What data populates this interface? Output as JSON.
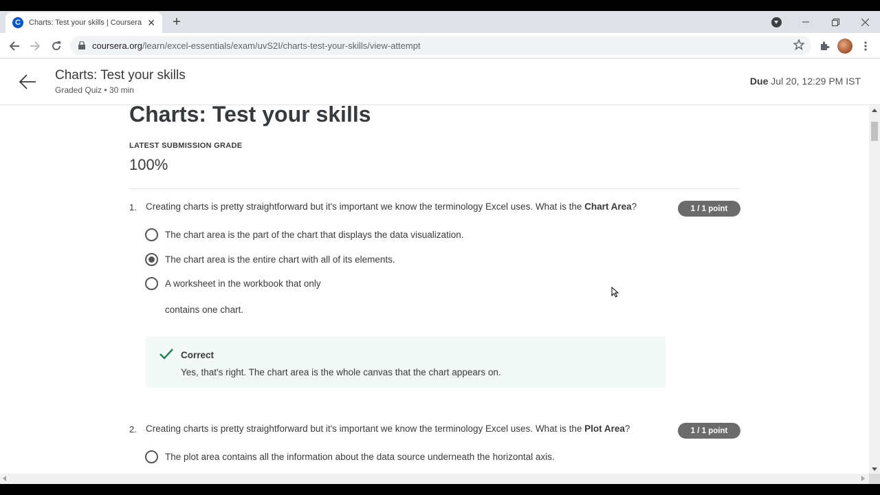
{
  "browser": {
    "tab_title": "Charts: Test your skills | Coursera",
    "favicon_letter": "C",
    "url_host": "coursera.org",
    "url_path": "/learn/excel-essentials/exam/uvS2I/charts-test-your-skills/view-attempt"
  },
  "header": {
    "title": "Charts: Test your skills",
    "subtitle": "Graded Quiz • 30 min",
    "due_label": "Due",
    "due_value": "Jul 20, 12:29 PM IST"
  },
  "quiz": {
    "title": "Charts: Test your skills",
    "grade_label": "LATEST SUBMISSION GRADE",
    "grade_value": "100%"
  },
  "questions": [
    {
      "number": "1.",
      "text_before": "Creating charts is pretty straightforward but it's important we know the terminology Excel uses. What is the ",
      "text_bold": "Chart Area",
      "text_after": "?",
      "points": "1 / 1 point",
      "options": [
        {
          "text": "The chart area is the part of the chart that displays the data visualization.",
          "selected": false
        },
        {
          "text": "The chart area is the entire chart with all of its elements.",
          "selected": true
        },
        {
          "text": "A worksheet in the workbook that only",
          "continuation": "contains one chart.",
          "selected": false
        }
      ],
      "feedback": {
        "title": "Correct",
        "text": "Yes, that's right. The chart area is the whole canvas that the chart appears on."
      }
    },
    {
      "number": "2.",
      "text_before": "Creating charts is pretty straightforward but it's important we know the terminology Excel uses. What is the ",
      "text_bold": "Plot Area",
      "text_after": "?",
      "points": "1 / 1 point",
      "options": [
        {
          "text": "The plot area contains all the information about the data source underneath the horizontal axis.",
          "selected": false
        }
      ]
    }
  ],
  "colors": {
    "brand": "#0056d2",
    "points_badge": "#6b6b6b",
    "correct_check": "#1f8354",
    "feedback_bg": "#f3f9f6"
  }
}
